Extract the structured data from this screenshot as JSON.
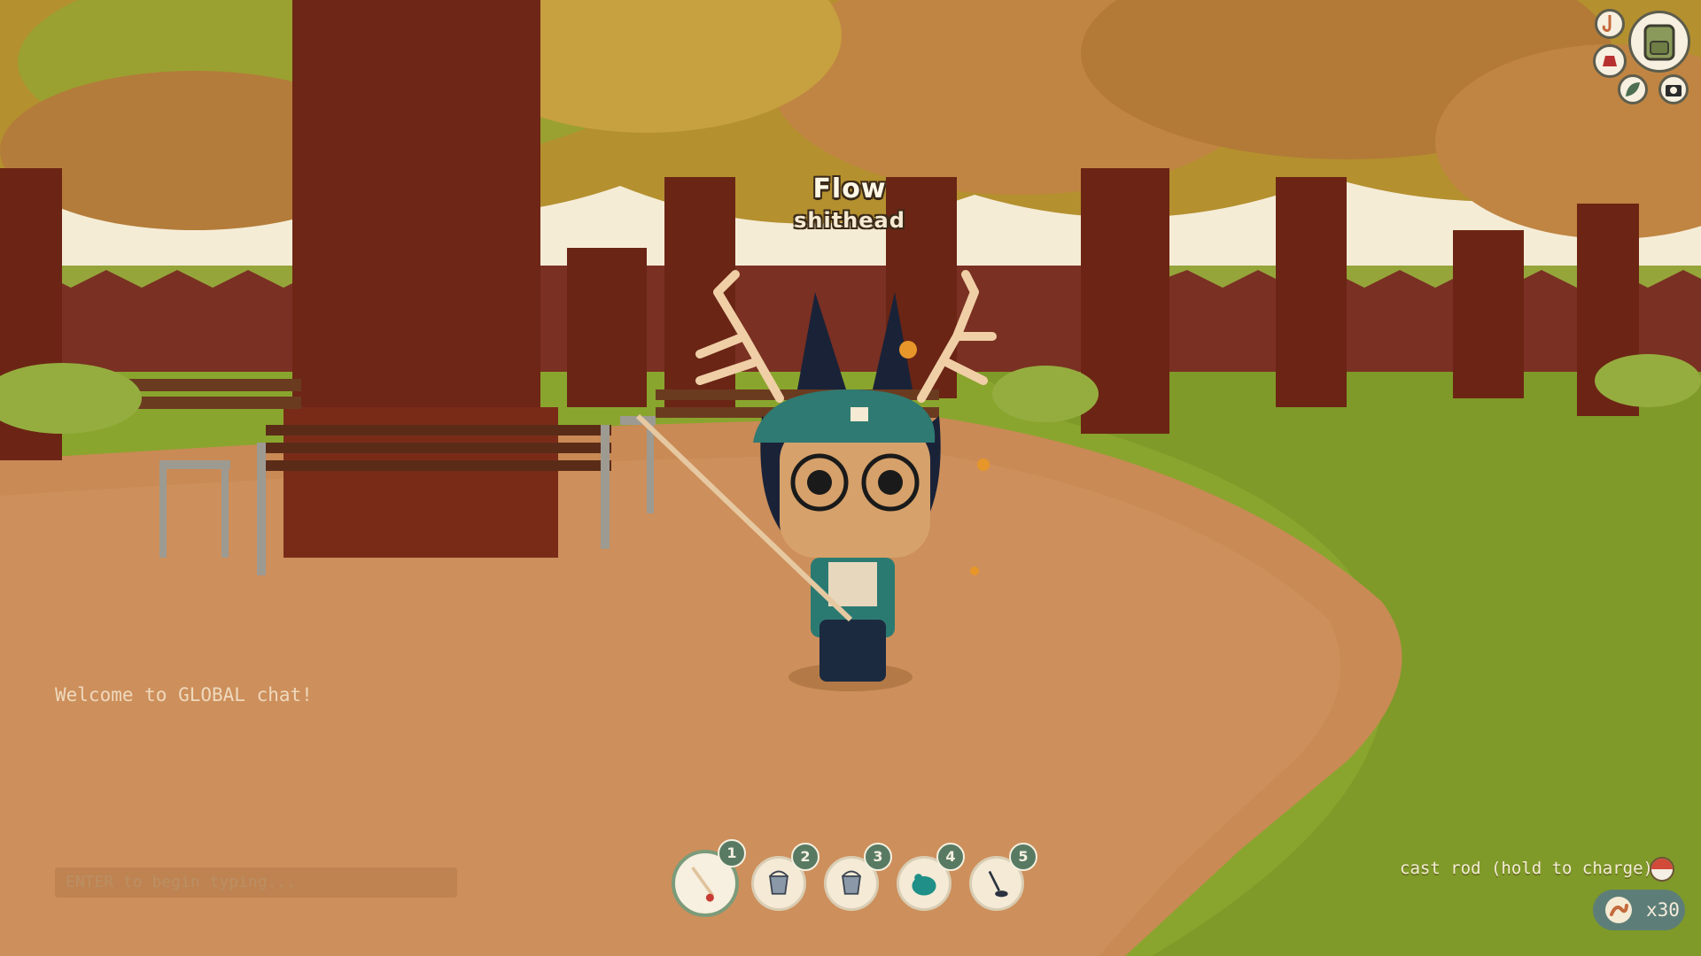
{
  "player": {
    "name": "Flow",
    "title": "shithead"
  },
  "chat": {
    "welcome": "Welcome to GLOBAL chat!",
    "input_placeholder": "ENTER to begin typing..."
  },
  "hotbar": {
    "slots": [
      {
        "number": "1",
        "item_icon": "fishing-rod-icon",
        "selected": true
      },
      {
        "number": "2",
        "item_icon": "bucket-icon",
        "selected": false
      },
      {
        "number": "3",
        "item_icon": "bucket-icon",
        "selected": false
      },
      {
        "number": "4",
        "item_icon": "teal-bag-icon",
        "selected": false
      },
      {
        "number": "5",
        "item_icon": "metal-detector-icon",
        "selected": false
      }
    ]
  },
  "action_hint": {
    "text": "cast rod (hold to charge)",
    "icon": "bobber-icon"
  },
  "bait": {
    "count": "x30",
    "icon": "worm-bait-icon"
  },
  "menu": {
    "buttons": [
      "backpack-icon",
      "fishing-hook-icon",
      "hat-icon",
      "leaf-icon",
      "camera-icon"
    ]
  },
  "colors": {
    "accent": "#587a63",
    "bait_pill": "#5d7e78",
    "path": "#c98a55",
    "grass": "#8aa52e"
  }
}
